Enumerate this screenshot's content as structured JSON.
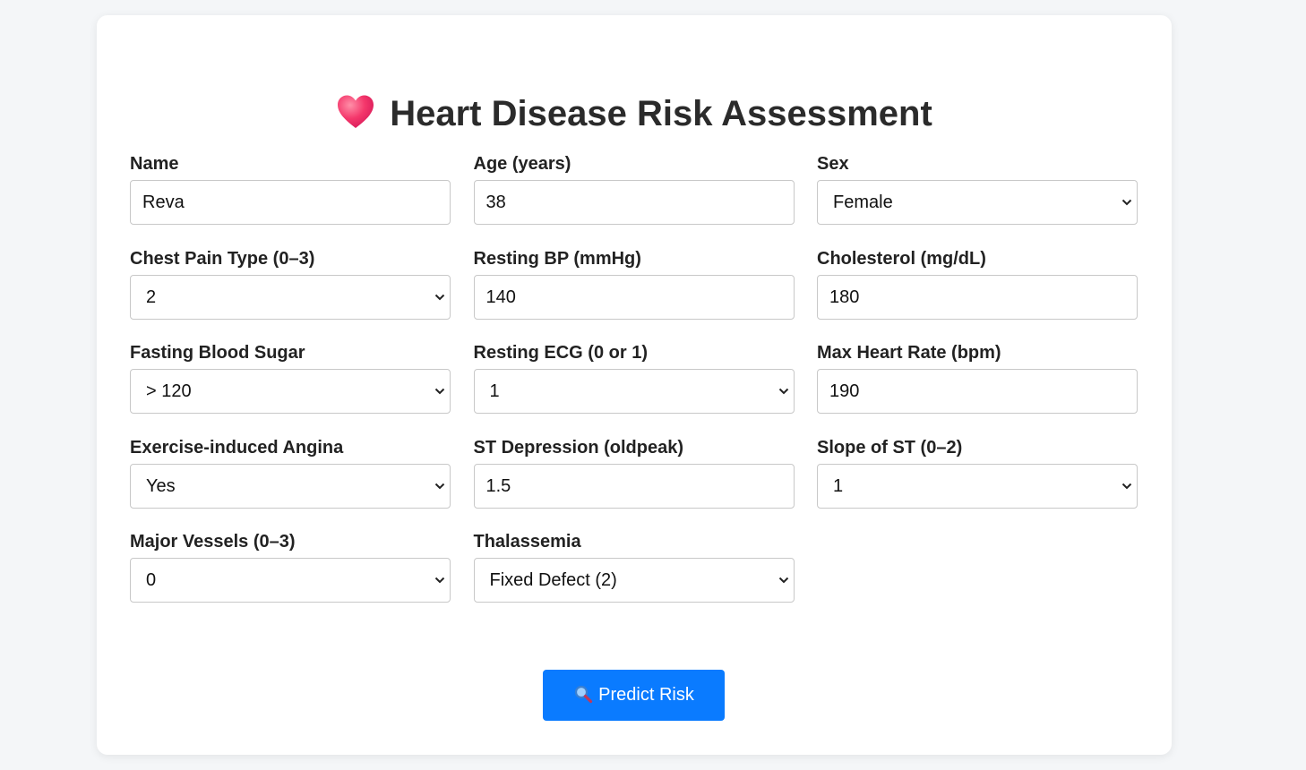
{
  "header": {
    "icon": "heart-icon",
    "title": "Heart Disease Risk Assessment"
  },
  "fields": [
    {
      "label": "Name",
      "type": "input",
      "value": "Reva"
    },
    {
      "label": "Age (years)",
      "type": "input",
      "value": "38"
    },
    {
      "label": "Sex",
      "type": "select",
      "value": "Female"
    },
    {
      "label": "Chest Pain Type (0–3)",
      "type": "select",
      "value": "2"
    },
    {
      "label": "Resting BP (mmHg)",
      "type": "input",
      "value": "140"
    },
    {
      "label": "Cholesterol (mg/dL)",
      "type": "input",
      "value": "180"
    },
    {
      "label": "Fasting Blood Sugar",
      "type": "select",
      "value": "> 120"
    },
    {
      "label": "Resting ECG (0 or 1)",
      "type": "select",
      "value": "1"
    },
    {
      "label": "Max Heart Rate (bpm)",
      "type": "input",
      "value": "190"
    },
    {
      "label": "Exercise-induced Angina",
      "type": "select",
      "value": "Yes"
    },
    {
      "label": "ST Depression (oldpeak)",
      "type": "input",
      "value": "1.5"
    },
    {
      "label": "Slope of ST (0–2)",
      "type": "select",
      "value": "1"
    },
    {
      "label": "Major Vessels (0–3)",
      "type": "select",
      "value": "0"
    },
    {
      "label": "Thalassemia",
      "type": "select",
      "value": "Fixed Defect (2)"
    }
  ],
  "button": {
    "icon": "magnifier-icon",
    "label": "Predict Risk"
  },
  "colors": {
    "accent": "#0a7bff",
    "heart": "#f0306a"
  }
}
